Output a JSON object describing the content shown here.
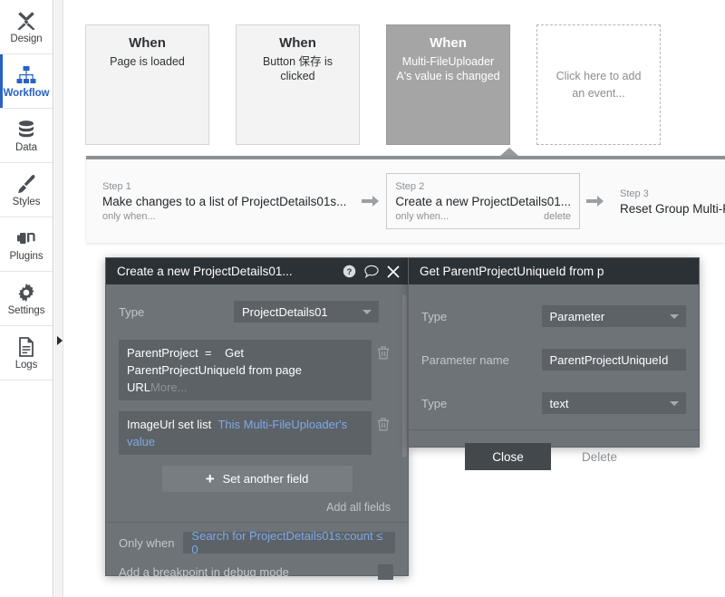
{
  "sidebar": {
    "items": [
      {
        "label": "Design",
        "icon": "design-tools-icon",
        "active": false
      },
      {
        "label": "Workflow",
        "icon": "workflow-nodes-icon",
        "active": true
      },
      {
        "label": "Data",
        "icon": "database-icon",
        "active": false
      },
      {
        "label": "Styles",
        "icon": "paintbrush-icon",
        "active": false
      },
      {
        "label": "Plugins",
        "icon": "plug-icon",
        "active": false
      },
      {
        "label": "Settings",
        "icon": "gear-icon",
        "active": false
      },
      {
        "label": "Logs",
        "icon": "document-lines-icon",
        "active": false
      }
    ],
    "collapse_icon": "collapse-triangle-icon",
    "accent_color": "#2962c4"
  },
  "events": [
    {
      "when": "When",
      "desc": "Page is loaded",
      "selected": false,
      "placeholder": false
    },
    {
      "when": "When",
      "desc": "Button 保存 is clicked",
      "selected": false,
      "placeholder": false
    },
    {
      "when": "When",
      "desc": "Multi-FileUploader A's value is changed",
      "selected": true,
      "placeholder": false
    },
    {
      "add_text": "Click here to add an event...",
      "placeholder": true
    }
  ],
  "steps": [
    {
      "number": "Step 1",
      "title": "Make changes to a list of ProjectDetails01s...",
      "only_when": "only when...",
      "delete": "",
      "selected": false
    },
    {
      "number": "Step 2",
      "title": "Create a new ProjectDetails01...",
      "only_when": "only when...",
      "delete": "delete",
      "selected": true
    },
    {
      "number": "Step 3",
      "title": "Reset Group Multi-File Uploader",
      "only_when": "",
      "delete": "",
      "selected": false
    }
  ],
  "step_arrow_icon": "arrow-right-icon",
  "action_dialog": {
    "title": "Create a new ProjectDetails01...",
    "icons": {
      "help": "help-circle-icon",
      "comment": "speech-bubble-icon",
      "close": "close-x-icon"
    },
    "type_label": "Type",
    "type_value": "ProjectDetails01",
    "fields": [
      {
        "name": "ParentProject",
        "operator": "=",
        "value": "Get ParentProjectUniqueId from page URL",
        "more": "More...",
        "delete_icon": "trash-icon"
      },
      {
        "name": "ImageUrl set list",
        "operator": "",
        "value": "This Multi-FileUploader's value",
        "more": "",
        "delete_icon": "trash-icon"
      }
    ],
    "set_another_field": "Set another field",
    "set_another_field_icon": "plus-icon",
    "add_all_fields": "Add all fields",
    "only_when_label": "Only when",
    "only_when_value": "Search for ProjectDetails01s:count ≤ 0",
    "breakpoint_label": "Add a breakpoint in debug mode",
    "breakpoint_checked": false
  },
  "param_dialog": {
    "title": "Get ParentProjectUniqueId from p",
    "rows": [
      {
        "label": "Type",
        "value": "Parameter",
        "kind": "dropdown"
      },
      {
        "label": "Parameter name",
        "value": "ParentProjectUniqueId",
        "kind": "text"
      },
      {
        "label": "Type",
        "value": "text",
        "kind": "dropdown"
      }
    ],
    "close_button": "Close",
    "delete_button": "Delete"
  }
}
